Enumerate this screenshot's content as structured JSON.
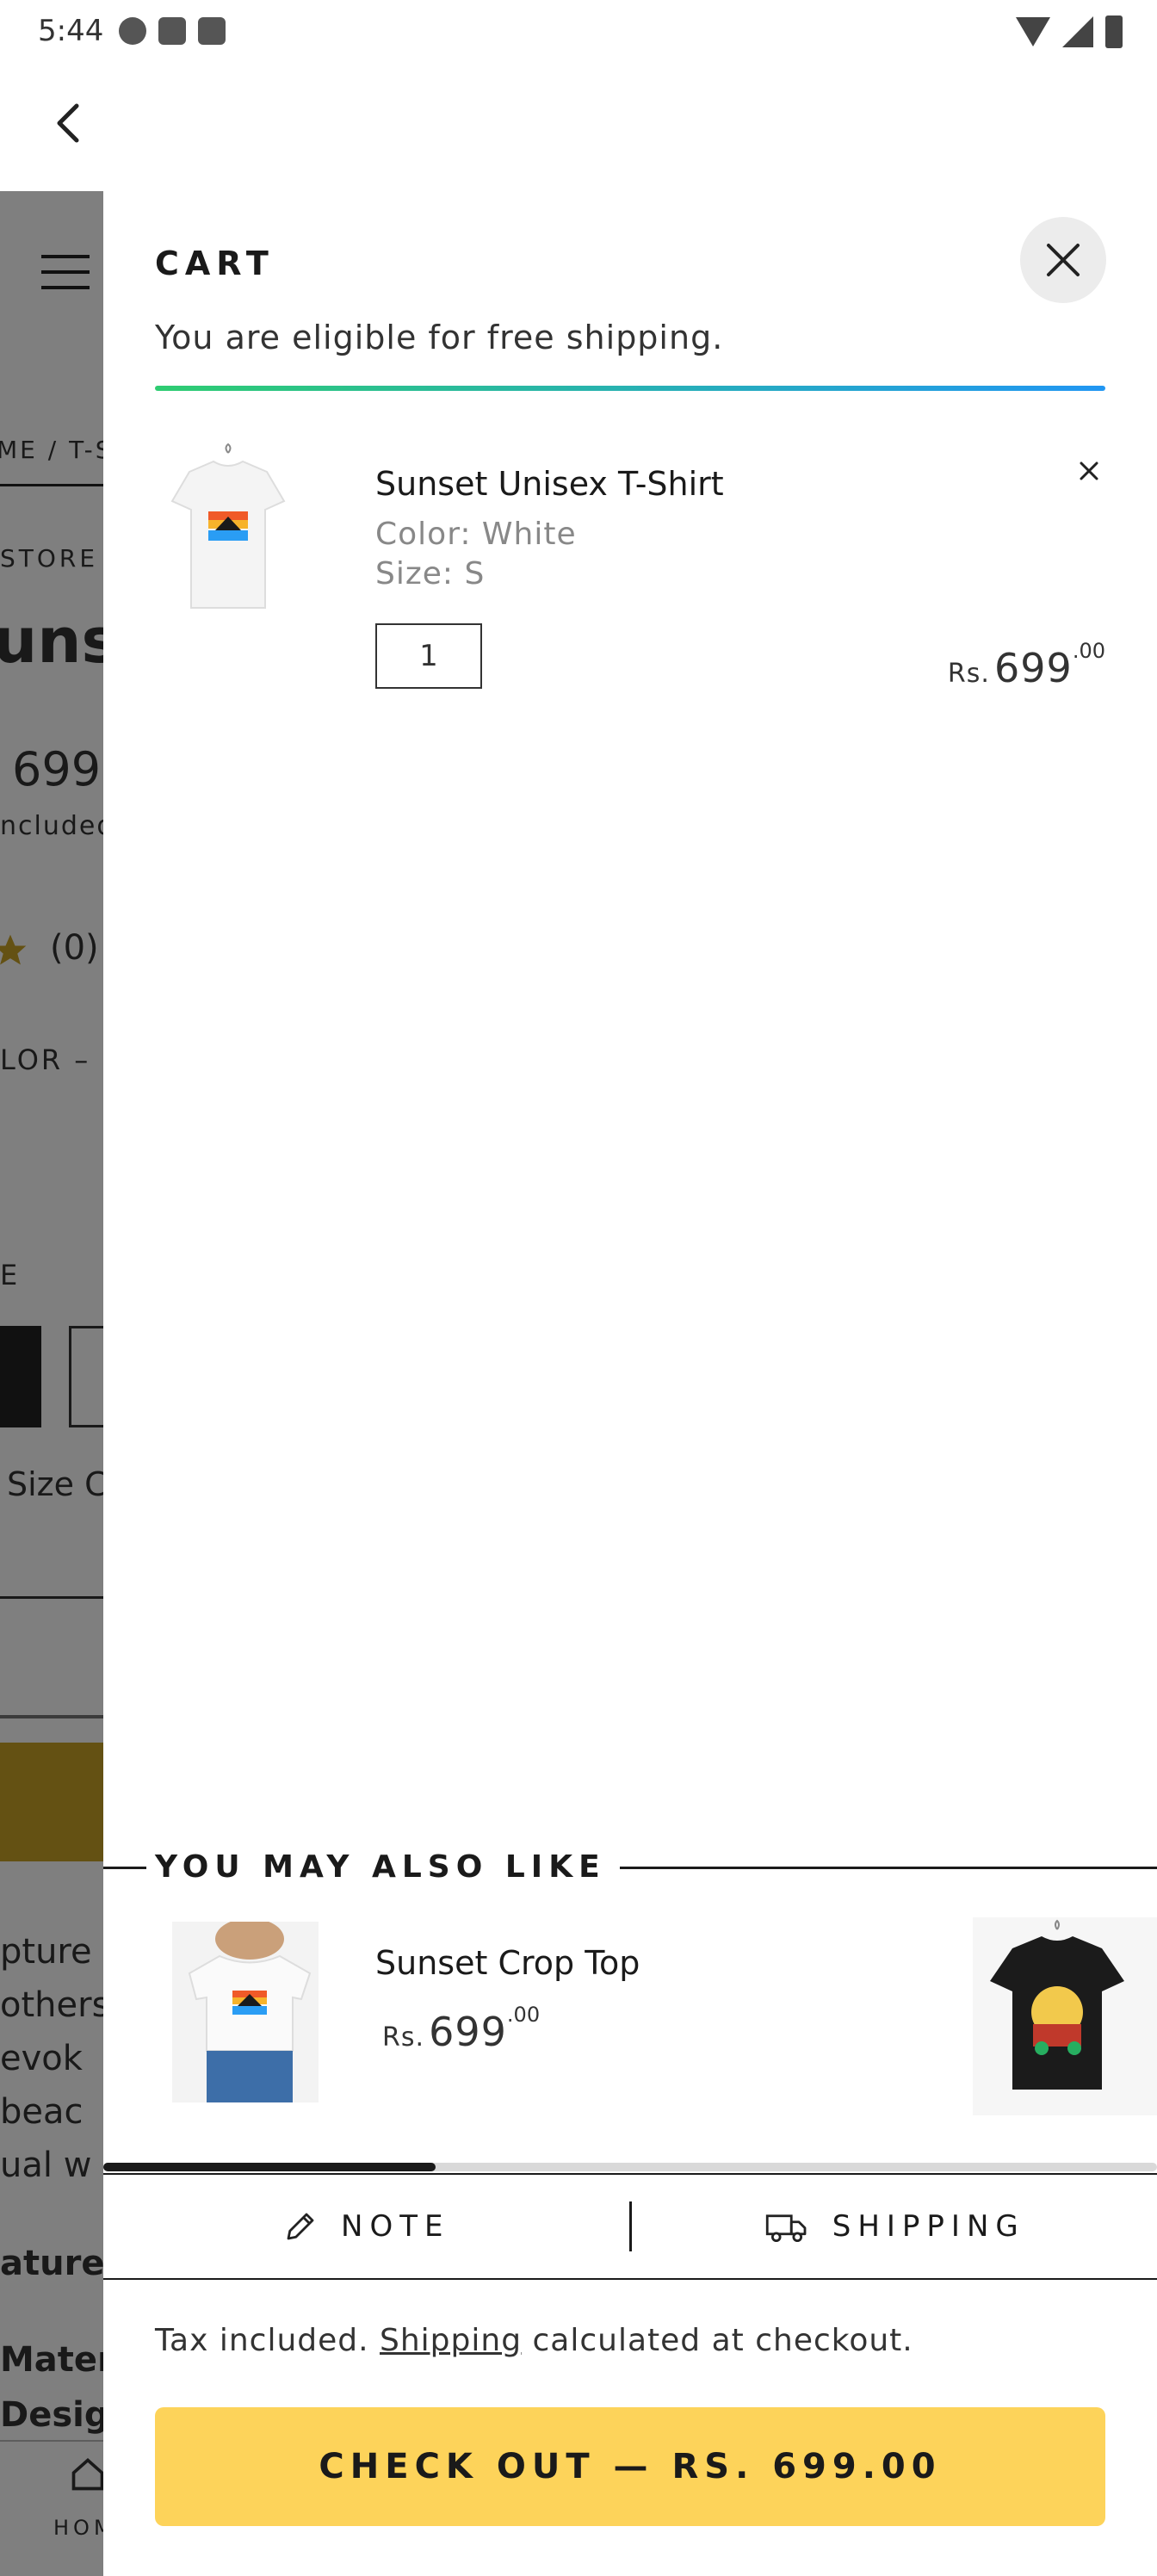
{
  "status_bar": {
    "time": "5:44"
  },
  "background_page": {
    "breadcrumb": "ME / T-S",
    "store": "STORE",
    "title": "unse",
    "price": "699",
    "tax": "ncluded",
    "rating": "(0)",
    "color_label": "LOR –",
    "size_label": "E",
    "size_chart": "Size C",
    "desc_lines": [
      "pture",
      "others",
      "evok",
      "beac",
      "ual w"
    ],
    "features": "atures",
    "material": "Mater",
    "design": "Desig",
    "home_tab": "HOM"
  },
  "cart": {
    "title": "CART",
    "shipping_message": "You are eligible for free shipping.",
    "items": [
      {
        "name": "Sunset Unisex T-Shirt",
        "color": "Color: White",
        "size": "Size: S",
        "quantity": "1",
        "currency": "Rs.",
        "price_main": "699",
        "price_cents": ".00"
      }
    ],
    "recommendations": {
      "title": "YOU MAY ALSO LIKE",
      "items": [
        {
          "name": "Sunset Crop Top",
          "currency": "Rs.",
          "price_main": "699",
          "price_cents": ".00"
        }
      ]
    },
    "tabs": {
      "note": "NOTE",
      "shipping": "SHIPPING"
    },
    "tax_note": {
      "prefix": "Tax included. ",
      "link": "Shipping",
      "suffix": " calculated at checkout."
    },
    "checkout_label": "CHECK OUT   —   RS. 699.00"
  }
}
